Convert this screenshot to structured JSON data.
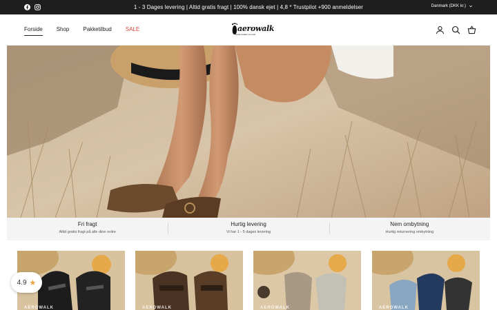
{
  "announcement": {
    "message": "1 - 3 Dages levering | Altid gratis fragt | 100% dansk ejet | 4,8 * Trustpilot +900 anmeldelser",
    "locale": "Danmark (DKK kr.)",
    "social_icons": [
      "facebook-icon",
      "instagram-icon"
    ]
  },
  "header": {
    "nav": [
      {
        "label": "Forside",
        "active": true
      },
      {
        "label": "Shop"
      },
      {
        "label": "Pakketilbud"
      },
      {
        "label": "SALE",
        "sale": true
      }
    ],
    "logo": {
      "text": "aerowalk",
      "tagline": "Gode Fødder vil smile"
    },
    "icons": [
      "account-icon",
      "search-icon",
      "cart-icon"
    ]
  },
  "usp": [
    {
      "title": "Fri fragt",
      "subtitle": "Altid gratis fragt på alle dine ordre"
    },
    {
      "title": "Hurtig levering",
      "subtitle": "Vi har 1 - 5 dages levering"
    },
    {
      "title": "Nem ombytning",
      "subtitle": "Hurtig returnering ombytning"
    }
  ],
  "products": [
    {
      "brand": "AEROWALK",
      "variant": "black"
    },
    {
      "brand": "AEROWALK",
      "variant": "brown"
    },
    {
      "brand": "AEROWALK",
      "variant": "beige"
    },
    {
      "brand": "AEROWALK",
      "variant": "blue"
    }
  ],
  "rating_badge": {
    "value": "4.9"
  },
  "colors": {
    "announce_bg": "#1e1e1e",
    "sale": "#d9453a",
    "star": "#e8a33a",
    "usp_bg": "#f4f4f4"
  }
}
